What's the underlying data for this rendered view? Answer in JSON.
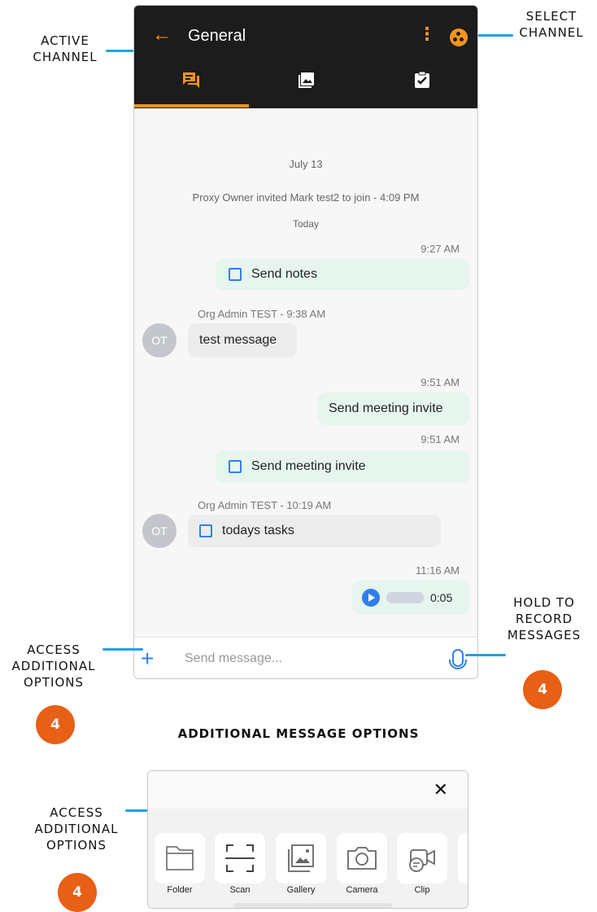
{
  "annotations": {
    "active_channel": [
      "ACTIVE",
      "CHANNEL"
    ],
    "select_channel": [
      "SELECT",
      "CHANNEL"
    ],
    "access_options": [
      "ACCESS",
      "ADDITIONAL",
      "OPTIONS"
    ],
    "hold_record": [
      "HOLD TO",
      "RECORD",
      "MESSAGES"
    ],
    "access_options_2": [
      "ACCESS",
      "ADDITIONAL",
      "OPTIONS"
    ],
    "step": "4",
    "section_heading": "ADDITIONAL MESSAGE OPTIONS"
  },
  "header": {
    "back_icon": "arrow-left-icon",
    "title": "General",
    "more_icon": "more-vertical-icon",
    "channel_icon": "channel-select-icon",
    "tabs": [
      {
        "icon": "chat-icon",
        "active": true
      },
      {
        "icon": "image-icon",
        "active": false
      },
      {
        "icon": "task-icon",
        "active": false
      }
    ]
  },
  "chat": {
    "date1": "July 13",
    "system_msg": "Proxy Owner invited Mark test2 to join - 4:09 PM",
    "date2": "Today",
    "msg1_time": "9:27 AM",
    "msg1_text": "Send notes",
    "msg2_sender": "Org Admin TEST - 9:38 AM",
    "msg2_avatar": "OT",
    "msg2_text": "test message",
    "msg3_time": "9:51 AM",
    "msg3_text": "Send meeting invite",
    "msg4_time": "9:51 AM",
    "msg4_text": "Send meeting invite",
    "msg5_sender": "Org Admin TEST - 10:19 AM",
    "msg5_avatar": "OT",
    "msg5_text": "todays tasks",
    "msg6_time": "11:16 AM",
    "msg6_duration": "0:05"
  },
  "input": {
    "plus_icon": "plus-icon",
    "placeholder": "Send message...",
    "mic_icon": "microphone-icon"
  },
  "options": {
    "close_icon": "close-icon",
    "items": [
      {
        "label": "Folder",
        "icon": "folder-icon"
      },
      {
        "label": "Scan",
        "icon": "scan-icon"
      },
      {
        "label": "Gallery",
        "icon": "gallery-icon"
      },
      {
        "label": "Camera",
        "icon": "camera-icon"
      },
      {
        "label": "Clip",
        "icon": "clip-icon"
      }
    ]
  },
  "colors": {
    "accent_orange": "#f7941d",
    "callout_blue": "#1ba3e0",
    "badge_orange": "#e85f16",
    "link_blue": "#2f80ed"
  }
}
